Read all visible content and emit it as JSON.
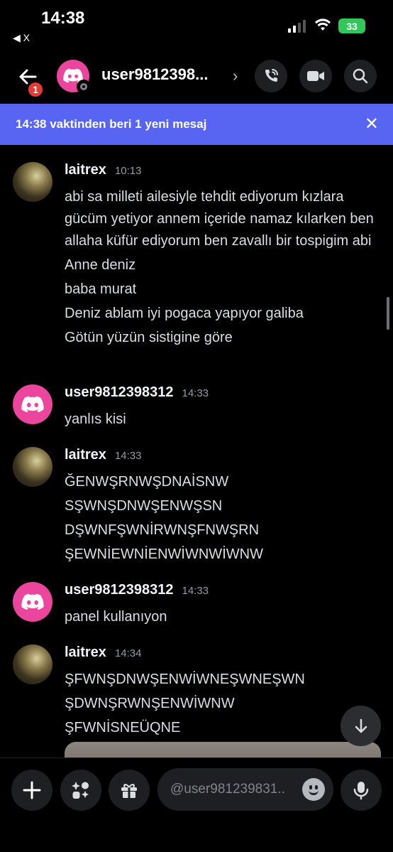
{
  "status_bar": {
    "time": "14:38",
    "back_app": "◀ X",
    "battery": "33"
  },
  "header": {
    "badge_count": "1",
    "name": "user9812398...",
    "chevron": "›"
  },
  "banner": {
    "text": "14:38 vaktinden beri 1 yeni mesaj",
    "close": "✕"
  },
  "messages": [
    {
      "author": "laitrex",
      "time": "10:13",
      "avatar": "photo",
      "lines": [
        "abi sa milleti ailesiyle tehdit ediyorum kızlara gücüm yetiyor annem içeride namaz kılarken ben allaha küfür ediyorum ben zavallı bir tospigim abi",
        "Anne deniz",
        "baba murat",
        "Deniz ablam iyi pogaca yapıyor galiba",
        "Götün yüzün sistigine göre"
      ]
    },
    {
      "author": "user9812398312",
      "time": "14:33",
      "avatar": "discord",
      "lines": [
        "yanlıs kisi"
      ]
    },
    {
      "author": "laitrex",
      "time": "14:33",
      "avatar": "photo",
      "lines": [
        "ĞENWŞRNWŞDNAİSNW",
        "SŞWNŞDNWŞENWŞSN",
        "DŞWNFŞWNİRWNŞFNWŞRN",
        "ŞEWNİEWNİENWİWNWİWNW"
      ]
    },
    {
      "author": "user9812398312",
      "time": "14:33",
      "avatar": "discord",
      "lines": [
        "panel kullanıyon"
      ]
    },
    {
      "author": "laitrex",
      "time": "14:34",
      "avatar": "photo",
      "lines": [
        "ŞFWNŞDNWŞENWİWNEŞWNEŞWN",
        "ŞDWNŞRWNŞENWİWNW",
        "ŞFWNİSNEÜQNE"
      ]
    }
  ],
  "composer": {
    "placeholder": "@user981239831.."
  },
  "icons": {
    "back": "arrow-left-icon",
    "call": "phone-call-icon",
    "video": "video-camera-icon",
    "search": "search-icon",
    "plus": "plus-icon",
    "apps": "apps-icon",
    "gift": "gift-icon",
    "emoji": "emoji-icon",
    "mic": "microphone-icon",
    "jump": "arrow-down-icon",
    "close": "close-icon"
  },
  "colors": {
    "blurple": "#5865f2",
    "discord_pink": "#eb459e",
    "badge_red": "#e53935"
  }
}
